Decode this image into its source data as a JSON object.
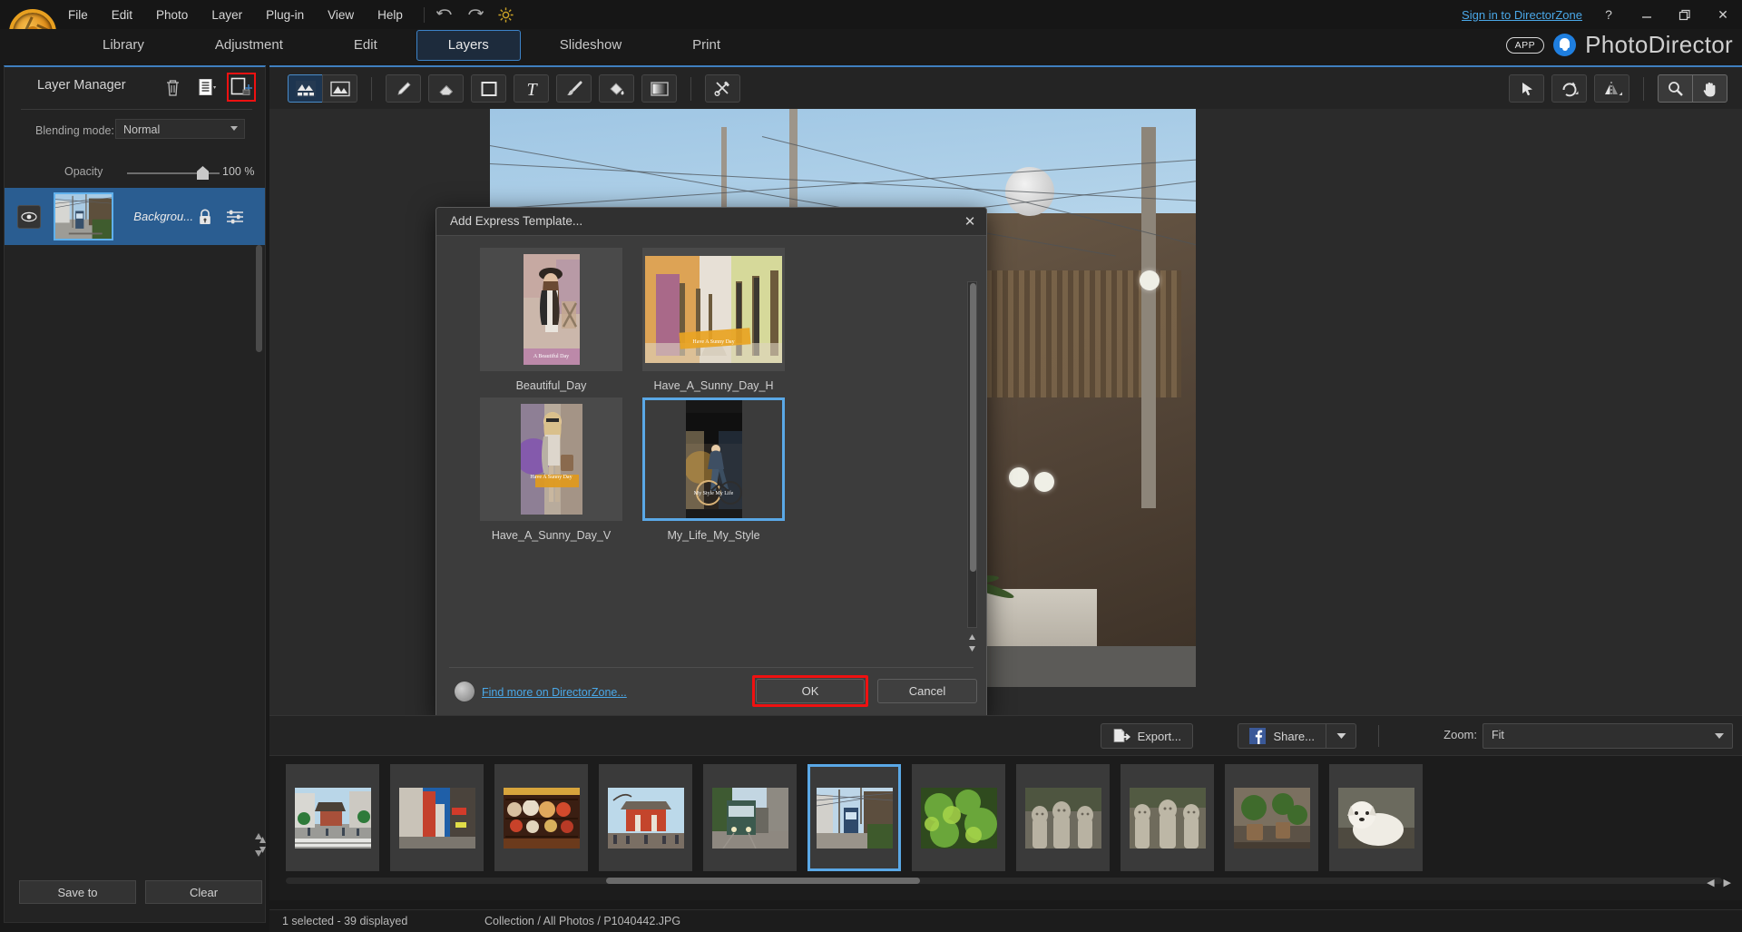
{
  "app": {
    "brand": "PhotoDirector",
    "app_chip": "APP",
    "signin": "Sign in to DirectorZone",
    "help_glyph": "?",
    "minimize_glyph": "—",
    "restore_glyph": "❐",
    "close_glyph": "✕"
  },
  "menu": {
    "items": [
      {
        "label": "File"
      },
      {
        "label": "Edit"
      },
      {
        "label": "Photo"
      },
      {
        "label": "Layer"
      },
      {
        "label": "Plug-in"
      },
      {
        "label": "View"
      },
      {
        "label": "Help"
      }
    ],
    "undo_icon": "undo-icon",
    "redo_icon": "redo-icon",
    "settings_icon": "gear-icon"
  },
  "modules": {
    "tabs": [
      {
        "label": "Library",
        "active": false
      },
      {
        "label": "Adjustment",
        "active": false
      },
      {
        "label": "Edit",
        "active": false
      },
      {
        "label": "Layers",
        "active": true
      },
      {
        "label": "Slideshow",
        "active": false
      },
      {
        "label": "Print",
        "active": false
      }
    ]
  },
  "layer_panel": {
    "title": "Layer Manager",
    "delete_icon": "trash-icon",
    "menu_icon": "layer-menu-icon",
    "add_template_icon": "add-express-template-icon",
    "blending_label": "Blending mode:",
    "blending_value": "Normal",
    "opacity_label": "Opacity",
    "opacity_value": "100 %",
    "layers": [
      {
        "name": "Backgrou...",
        "visible": true,
        "locked": true,
        "selected": true,
        "eye_icon": "eye-icon",
        "lock_icon": "lock-icon",
        "adjust_icon": "sliders-icon"
      }
    ],
    "save_to_label": "Save to",
    "clear_label": "Clear",
    "highlight_color": "#ef1111",
    "selected_row_color": "#2a5d91"
  },
  "edit_toolbar": {
    "tools": [
      {
        "name": "express-template-tool",
        "icon": "express-template-icon",
        "state": "on"
      },
      {
        "name": "image-layer-tool",
        "icon": "image-layer-icon",
        "state": "off"
      },
      {
        "name": "pencil-tool",
        "icon": "pencil-icon",
        "state": "off"
      },
      {
        "name": "eraser-tool",
        "icon": "eraser-icon",
        "state": "off"
      },
      {
        "name": "shape-tool",
        "icon": "rectangle-icon",
        "state": "off"
      },
      {
        "name": "text-tool",
        "icon": "text-t-icon",
        "state": "off"
      },
      {
        "name": "brush-tool",
        "icon": "paint-brush-icon",
        "state": "off"
      },
      {
        "name": "fill-tool",
        "icon": "paint-bucket-icon",
        "state": "off"
      },
      {
        "name": "gradient-tool",
        "icon": "gradient-icon",
        "state": "off"
      },
      {
        "name": "settings-tool",
        "icon": "tools-cross-icon",
        "state": "off"
      }
    ],
    "right_tools": [
      {
        "name": "select-tool",
        "icon": "cursor-arrow-icon",
        "state": "off"
      },
      {
        "name": "rotate-tool",
        "icon": "rotate-icon",
        "state": "off"
      },
      {
        "name": "flip-tool",
        "icon": "flip-icon",
        "state": "off"
      },
      {
        "name": "zoom-tool",
        "icon": "magnifier-icon",
        "state": "pressed"
      },
      {
        "name": "pan-tool",
        "icon": "hand-icon",
        "state": "pressed"
      }
    ]
  },
  "dialog": {
    "title": "Add Express Template...",
    "close_glyph": "✕",
    "templates": [
      {
        "label": "Beautiful_Day",
        "selected": false,
        "caption": "A Beautiful Day",
        "orientation": "portrait"
      },
      {
        "label": "Have_A_Sunny_Day_H",
        "selected": false,
        "caption": "Have A Sunny Day",
        "orientation": "landscape"
      },
      {
        "label": "Have_A_Sunny_Day_V",
        "selected": false,
        "caption": "Have A Sunny Day",
        "orientation": "portrait"
      },
      {
        "label": "My_Life_My_Style",
        "selected": true,
        "caption": "My Style My Life",
        "orientation": "portrait"
      }
    ],
    "directorzone_link": "Find more on DirectorZone...",
    "directorzone_icon": "directorzone-icon",
    "ok_label": "OK",
    "cancel_label": "Cancel",
    "ok_highlight_color": "#ef1111"
  },
  "bottom_bar": {
    "export_label": "Export...",
    "export_icon": "export-icon",
    "share_label": "Share...",
    "share_icon": "facebook-icon",
    "share_caret_icon": "chevron-down-icon",
    "zoom_label": "Zoom:",
    "zoom_value": "Fit",
    "zoom_caret_icon": "chevron-down-icon"
  },
  "filmstrip": {
    "items": [
      {
        "name": "photo-temple-street",
        "selected": false
      },
      {
        "name": "photo-city-street",
        "selected": false
      },
      {
        "name": "photo-masks-shop",
        "selected": false
      },
      {
        "name": "photo-temple-gate",
        "selected": false
      },
      {
        "name": "photo-green-train",
        "selected": false
      },
      {
        "name": "photo-blue-train",
        "selected": true
      },
      {
        "name": "photo-green-leaves",
        "selected": false
      },
      {
        "name": "photo-stone-statues-a",
        "selected": false
      },
      {
        "name": "photo-stone-statues-b",
        "selected": false
      },
      {
        "name": "photo-plants-pots",
        "selected": false
      },
      {
        "name": "photo-white-dog",
        "selected": false
      }
    ],
    "prev_glyph": "◀",
    "next_glyph": "▶"
  },
  "status_bar": {
    "selection": "1 selected - 39 displayed",
    "path": "Collection / All Photos / P1040442.JPG"
  }
}
